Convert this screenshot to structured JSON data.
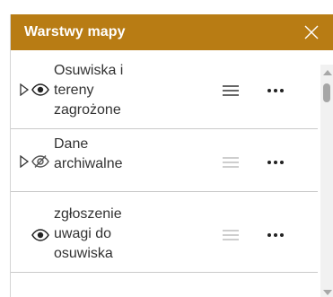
{
  "header": {
    "title": "Warstwy mapy",
    "background_color": "#b87c14",
    "close_icon": "close-icon"
  },
  "layers": [
    {
      "label_lines": [
        "Osuwiska i",
        "tereny",
        "zagrożone"
      ],
      "expandable": true,
      "visible": true,
      "eye_icon": "eye-icon",
      "legend_icon": "list-icon",
      "more_icon": "ellipsis-icon"
    },
    {
      "label_lines": [
        "Dane",
        "archiwalne"
      ],
      "expandable": true,
      "visible": false,
      "eye_icon": "eye-off-icon",
      "legend_icon": "list-icon",
      "more_icon": "ellipsis-icon"
    },
    {
      "label_lines": [
        "zgłoszenie",
        "uwagi do",
        "osuwiska"
      ],
      "expandable": false,
      "visible": true,
      "eye_icon": "eye-icon",
      "legend_icon": "list-icon",
      "more_icon": "ellipsis-icon"
    }
  ]
}
